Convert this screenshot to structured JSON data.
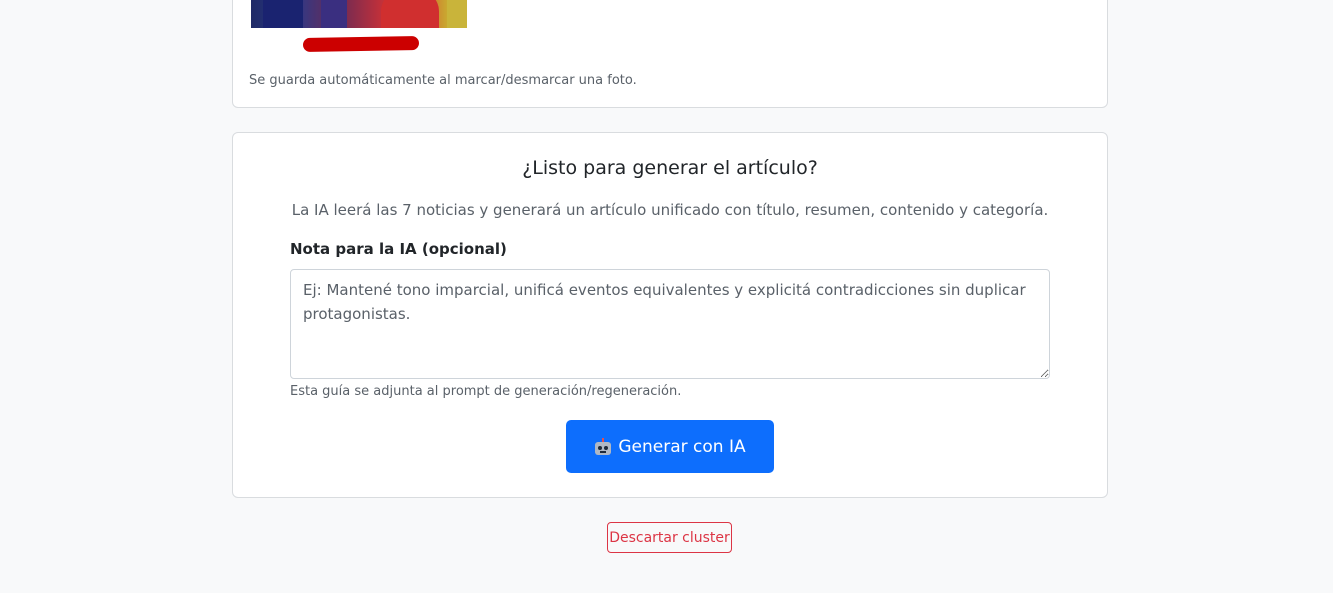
{
  "photos": {
    "hint": "Se guarda automáticamente al marcar/desmarcar una foto."
  },
  "generate": {
    "title": "¿Listo para generar el artículo?",
    "description": "La IA leerá las 7 noticias y generará un artículo unificado con título, resumen, contenido y categoría.",
    "note_label": "Nota para la IA (opcional)",
    "note_placeholder": "Ej: Mantené tono imparcial, unificá eventos equivalentes y explicitá contradicciones sin duplicar protagonistas.",
    "note_value": "",
    "note_help": "Esta guía se adjunta al prompt de generación/regeneración.",
    "button_label": "Generar con IA",
    "button_icon": "robot-icon"
  },
  "discard": {
    "label": "Descartar cluster"
  },
  "colors": {
    "primary": "#0d6efd",
    "danger": "#dc3545",
    "background": "#f8f9fa",
    "muted_text": "#5a6169"
  }
}
